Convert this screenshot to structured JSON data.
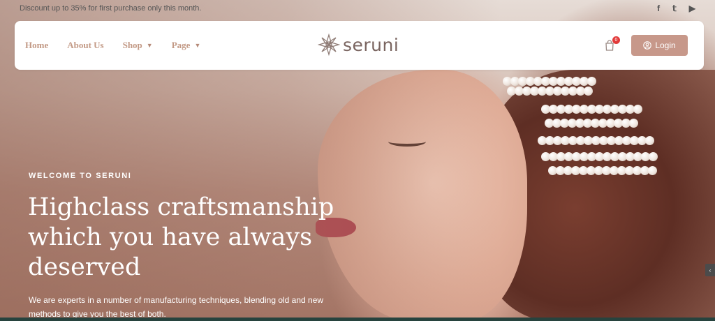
{
  "topbar": {
    "promo_text": "Discount up to 35% for first purchase only this month.",
    "socials": [
      {
        "icon": "facebook-icon",
        "glyph": "f"
      },
      {
        "icon": "twitter-icon",
        "glyph": "𝕥"
      },
      {
        "icon": "youtube-icon",
        "glyph": "▶"
      }
    ]
  },
  "nav": {
    "links": [
      {
        "label": "Home",
        "dropdown": false
      },
      {
        "label": "About Us",
        "dropdown": false
      },
      {
        "label": "Shop",
        "dropdown": true
      },
      {
        "label": "Page",
        "dropdown": true
      }
    ],
    "logo_text": "seruni",
    "cart_count": "0",
    "login_label": "Login"
  },
  "hero": {
    "eyebrow": "WELCOME TO SERUNI",
    "headline": "Highclass craftsmanship which you have always deserved",
    "subtext": "We are experts in a number of manufacturing techniques, blending old and new methods to give you the best of both."
  },
  "colors": {
    "accent": "#c7988a",
    "nav_link": "#c39a86",
    "badge": "#e23b3b",
    "bottom_strip": "#27433e"
  }
}
